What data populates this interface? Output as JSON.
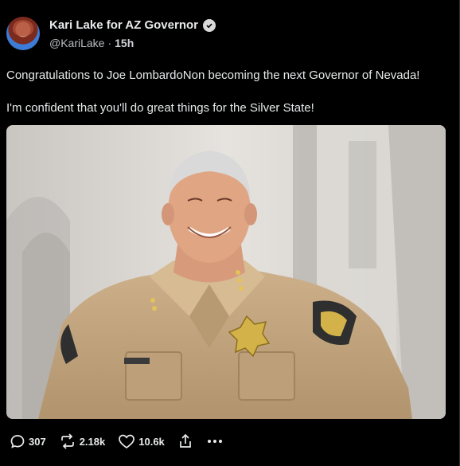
{
  "post": {
    "author_name": "Kari Lake for AZ Governor",
    "handle": "@KariLake",
    "separator": "·",
    "time": "15h",
    "line1": "Congratulations to Joe LombardoNon becoming the next Governor of Nevada!",
    "line2": "I'm confident that you'll do great things for the Silver State!",
    "stats": {
      "replies": "307",
      "reposts": "2.18k",
      "likes": "10.6k"
    }
  },
  "colors": {
    "background": "#000000",
    "text": "#e7e9ea",
    "uniform": "#c8ad86"
  },
  "icons": [
    "verified-badge-icon",
    "reply-icon",
    "repost-icon",
    "like-icon",
    "share-icon",
    "more-icon"
  ]
}
